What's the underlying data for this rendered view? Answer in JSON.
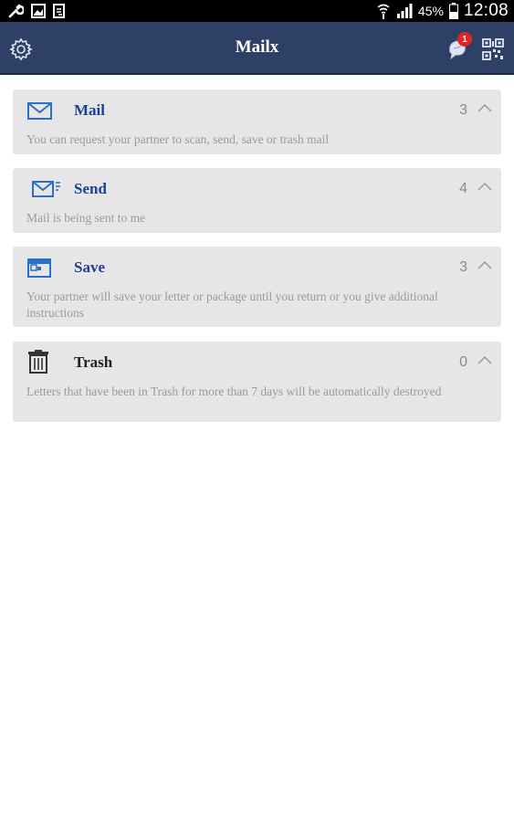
{
  "status_bar": {
    "battery_percent": "45%",
    "time": "12:08"
  },
  "app_bar": {
    "title": "Mailx",
    "notification_count": "1"
  },
  "cards": [
    {
      "title": "Mail",
      "count": "3",
      "description": "You can request your partner to scan, send, save or trash mail",
      "icon": "envelope-icon"
    },
    {
      "title": "Send",
      "count": "4",
      "description": "Mail is being sent to me",
      "icon": "envelope-send-icon"
    },
    {
      "title": "Save",
      "count": "3",
      "description": "Your partner will save your letter or package until you return or you give additional instructions",
      "icon": "save-box-icon"
    },
    {
      "title": "Trash",
      "count": "0",
      "description": "Letters that have been in Trash for more than 7 days will be automatically destroyed",
      "icon": "trash-icon"
    }
  ],
  "colors": {
    "app_bar": "#2e4066",
    "card_bg": "#e6e6e6",
    "title_blue": "#1c3f9a",
    "badge_red": "#e02424"
  }
}
